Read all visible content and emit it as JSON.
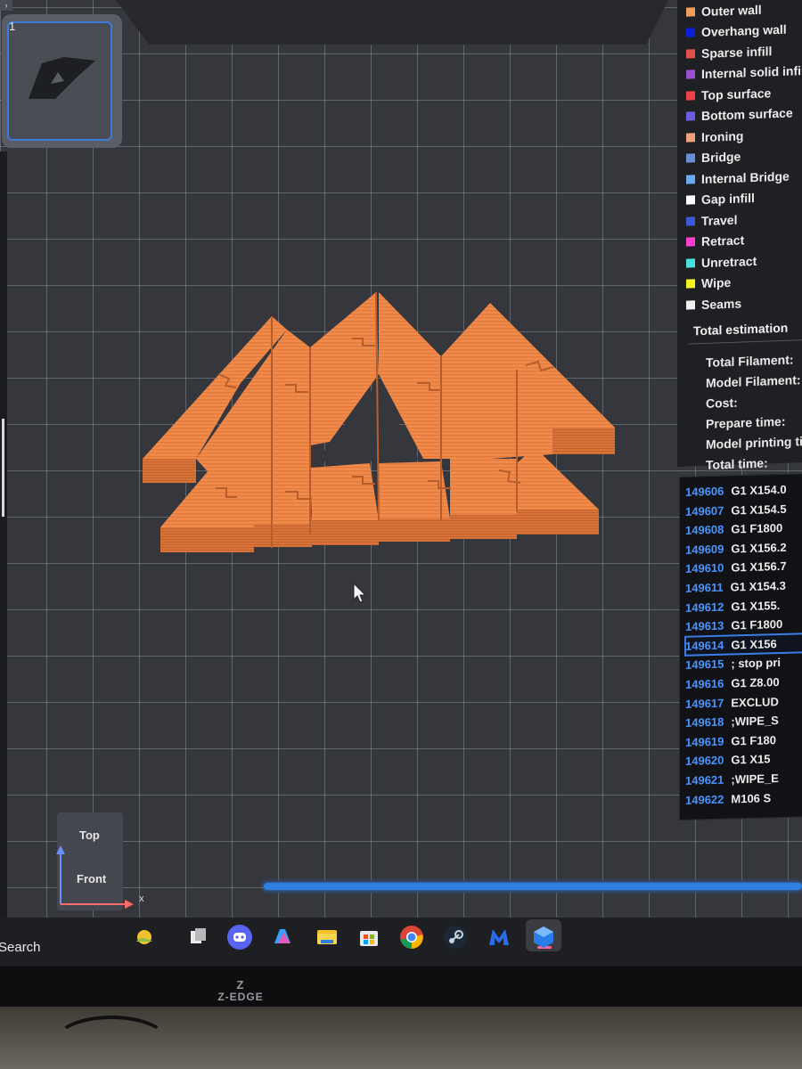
{
  "plate": {
    "number": "1"
  },
  "viewport": {
    "gizmo": {
      "top_label": "Top",
      "front_label": "Front",
      "x_axis": "x"
    },
    "slider_progress": 1.0
  },
  "legend": {
    "items": [
      {
        "label": "Outer wall",
        "color": "#f0a05a"
      },
      {
        "label": "Overhang wall",
        "color": "#0a1fd8"
      },
      {
        "label": "Sparse infill",
        "color": "#e0524a"
      },
      {
        "label": "Internal solid infill",
        "color": "#9a4fd0"
      },
      {
        "label": "Top surface",
        "color": "#f0404a"
      },
      {
        "label": "Bottom surface",
        "color": "#6a5fe0"
      },
      {
        "label": "Ironing",
        "color": "#f0a07a"
      },
      {
        "label": "Bridge",
        "color": "#6a8fd8"
      },
      {
        "label": "Internal Bridge",
        "color": "#6aaaf0"
      },
      {
        "label": "Gap infill",
        "color": "#ffffff"
      },
      {
        "label": "Travel",
        "color": "#3a5ad8"
      },
      {
        "label": "Retract",
        "color": "#ff3fd0"
      },
      {
        "label": "Unretract",
        "color": "#4ae0e0"
      },
      {
        "label": "Wipe",
        "color": "#f5f21e"
      },
      {
        "label": "Seams",
        "color": "#f0f0f0"
      }
    ],
    "estimation_title": "Total estimation",
    "estimation_rows": [
      "Total Filament:",
      "Model Filament:",
      "Cost:",
      "Prepare time:",
      "Model printing tim",
      "Total time:"
    ]
  },
  "gcode": {
    "lines": [
      {
        "num": "149606",
        "text": "G1 X154.0"
      },
      {
        "num": "149607",
        "text": "G1 X154.5"
      },
      {
        "num": "149608",
        "text": "G1 F1800"
      },
      {
        "num": "149609",
        "text": "G1 X156.2"
      },
      {
        "num": "149610",
        "text": "G1 X156.7"
      },
      {
        "num": "149611",
        "text": "G1 X154.3"
      },
      {
        "num": "149612",
        "text": "G1 X155."
      },
      {
        "num": "149613",
        "text": "G1 F1800"
      },
      {
        "num": "149614",
        "text": "G1 X156"
      },
      {
        "num": "149615",
        "text": "; stop pri"
      },
      {
        "num": "149616",
        "text": "G1 Z8.00"
      },
      {
        "num": "149617",
        "text": "EXCLUD"
      },
      {
        "num": "149618",
        "text": ";WIPE_S"
      },
      {
        "num": "149619",
        "text": "G1 F180"
      },
      {
        "num": "149620",
        "text": "G1 X15"
      },
      {
        "num": "149621",
        "text": ";WIPE_E"
      },
      {
        "num": "149622",
        "text": "M106 S"
      }
    ],
    "selected_line": "149614"
  },
  "taskbar": {
    "search_text": "Search",
    "icons": [
      "weather-icon",
      "task-view-icon",
      "discord-icon",
      "copilot-icon",
      "file-explorer-icon",
      "ms-store-icon",
      "chrome-icon",
      "steam-icon",
      "malwarebytes-icon",
      "bambu-studio-icon"
    ]
  },
  "monitor": {
    "brand": "Z-EDGE"
  },
  "colors": {
    "model": "#f08a4b",
    "accent": "#2f7fe0",
    "grid_bg": "#35373d"
  }
}
